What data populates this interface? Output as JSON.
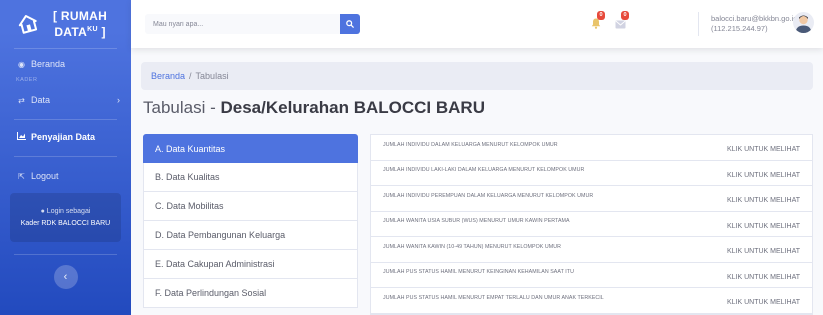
{
  "sidebar": {
    "brand_line1": "[ RUMAH",
    "brand_line2": "DATA",
    "brand_sup": "KU",
    "brand_close": " ]",
    "nav_beranda": "Beranda",
    "heading_kader": "KADER",
    "nav_data": "Data",
    "nav_penyajian": "Penyajian Data",
    "nav_logout": "Logout",
    "login_as": "Login sebagai",
    "login_role": "Kader RDK BALOCCI BARU"
  },
  "topbar": {
    "search_placeholder": "Mau nyari apa...",
    "alerts_count": "0",
    "messages_count": "0",
    "user_email": "balocci.baru@bkkbn.go.id",
    "user_ip": "(112.215.244.97)"
  },
  "breadcrumb": {
    "home": "Beranda",
    "separator": "/",
    "current": "Tabulasi"
  },
  "page": {
    "title_prefix": "Tabulasi - ",
    "title_bold": "Desa/Kelurahan BALOCCI BARU"
  },
  "categories": [
    "A. Data Kuantitas",
    "B. Data Kualitas",
    "C. Data Mobilitas",
    "D. Data Pembangunan Keluarga",
    "E. Data Cakupan Administrasi",
    "F. Data Perlindungan Sosial"
  ],
  "table": {
    "link_text": "KLIK UNTUK MELIHAT",
    "rows": [
      "JUMLAH INDIVIDU DALAM KELUARGA MENURUT KELOMPOK UMUR",
      "JUMLAH INDIVIDU LAKI-LAKI DALAM KELUARGA MENURUT KELOMPOK UMUR",
      "JUMLAH INDIVIDU PEREMPUAN DALAM KELUARGA MENURUT KELOMPOK UMUR",
      "JUMLAH WANITA USIA SUBUR (WUS) MENURUT UMUR KAWIN PERTAMA",
      "JUMLAH WANITA KAWIN (10-49 TAHUN) MENURUT KELOMPOK UMUR",
      "JUMLAH PUS STATUS HAMIL MENURUT KEINGINAN KEHAMILAN SAAT ITU",
      "JUMLAH PUS STATUS HAMIL MENURUT EMPAT TERLALU DAN UMUR ANAK TERKECIL"
    ]
  },
  "icons": {
    "brand": "house-icon",
    "beranda": "palette-icon",
    "data": "exchange-icon",
    "penyajian": "chart-area-icon",
    "logout": "sign-out-icon",
    "login": "user-icon",
    "toggle": "chevron-left-icon",
    "search": "search-icon",
    "alerts": "bell-icon",
    "messages": "envelope-icon"
  },
  "colors": {
    "primary": "#4e73df",
    "danger": "#e74a3b",
    "alert_icon": "#e9c46a"
  }
}
